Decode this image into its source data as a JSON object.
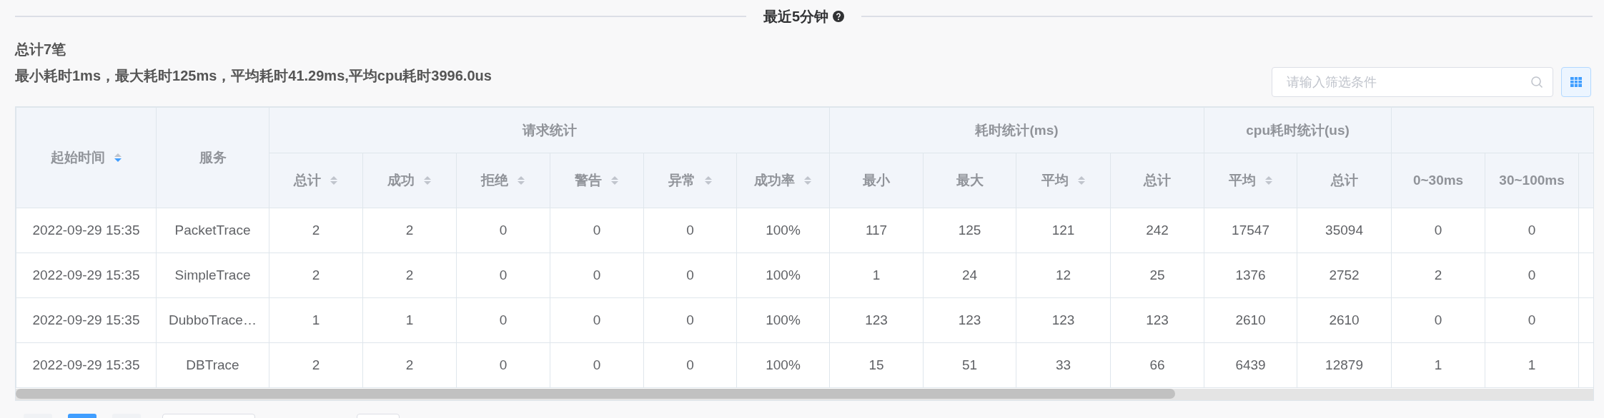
{
  "section_title": {
    "text": "最近5分钟"
  },
  "summary": {
    "count": "总计7笔",
    "stats": "最小耗时1ms，最大耗时125ms，平均耗时41.29ms,平均cpu耗时3996.0us"
  },
  "filter": {
    "placeholder": "请输入筛选条件"
  },
  "table": {
    "header": [
      {
        "label": "起始时间",
        "sort_descending": true
      },
      {
        "label": "服务"
      },
      {
        "label": "请求统计",
        "children": [
          {
            "label": "总计",
            "sort_descending": false
          },
          {
            "label": "成功",
            "sort_descending": false
          },
          {
            "label": "拒绝",
            "sort_descending": false
          },
          {
            "label": "警告",
            "sort_descending": false
          },
          {
            "label": "异常",
            "sort_descending": false
          },
          {
            "label": "成功率",
            "sort_descending": false
          }
        ]
      },
      {
        "label": "耗时统计(ms)",
        "children": [
          {
            "label": "最小"
          },
          {
            "label": "最大"
          },
          {
            "label": "平均",
            "sort_descending": false
          },
          {
            "label": "总计"
          }
        ]
      },
      {
        "label": "cpu耗时统计(us)",
        "children": [
          {
            "label": "平均",
            "sort_descending": false
          },
          {
            "label": "总计"
          }
        ]
      },
      {
        "children": [
          {
            "label": "0~30ms"
          },
          {
            "label": "30~100ms"
          }
        ]
      }
    ],
    "rows": [
      [
        "2022-09-29 15:35",
        "PacketTrace",
        "2",
        "2",
        "0",
        "0",
        "0",
        "100%",
        "117",
        "125",
        "121",
        "242",
        "17547",
        "35094",
        "0",
        "0"
      ],
      [
        "2022-09-29 15:35",
        "SimpleTrace",
        "2",
        "2",
        "0",
        "0",
        "0",
        "100%",
        "1",
        "24",
        "12",
        "25",
        "1376",
        "2752",
        "2",
        "0"
      ],
      [
        "2022-09-29 15:35",
        "DubboTrace…",
        "1",
        "1",
        "0",
        "0",
        "0",
        "100%",
        "123",
        "123",
        "123",
        "123",
        "2610",
        "2610",
        "0",
        "0"
      ],
      [
        "2022-09-29 15:35",
        "DBTrace",
        "2",
        "2",
        "0",
        "0",
        "0",
        "100%",
        "15",
        "51",
        "33",
        "66",
        "6439",
        "12879",
        "1",
        "1"
      ]
    ]
  },
  "pagination": {
    "pages": [
      {
        "selected": true
      }
    ]
  }
}
